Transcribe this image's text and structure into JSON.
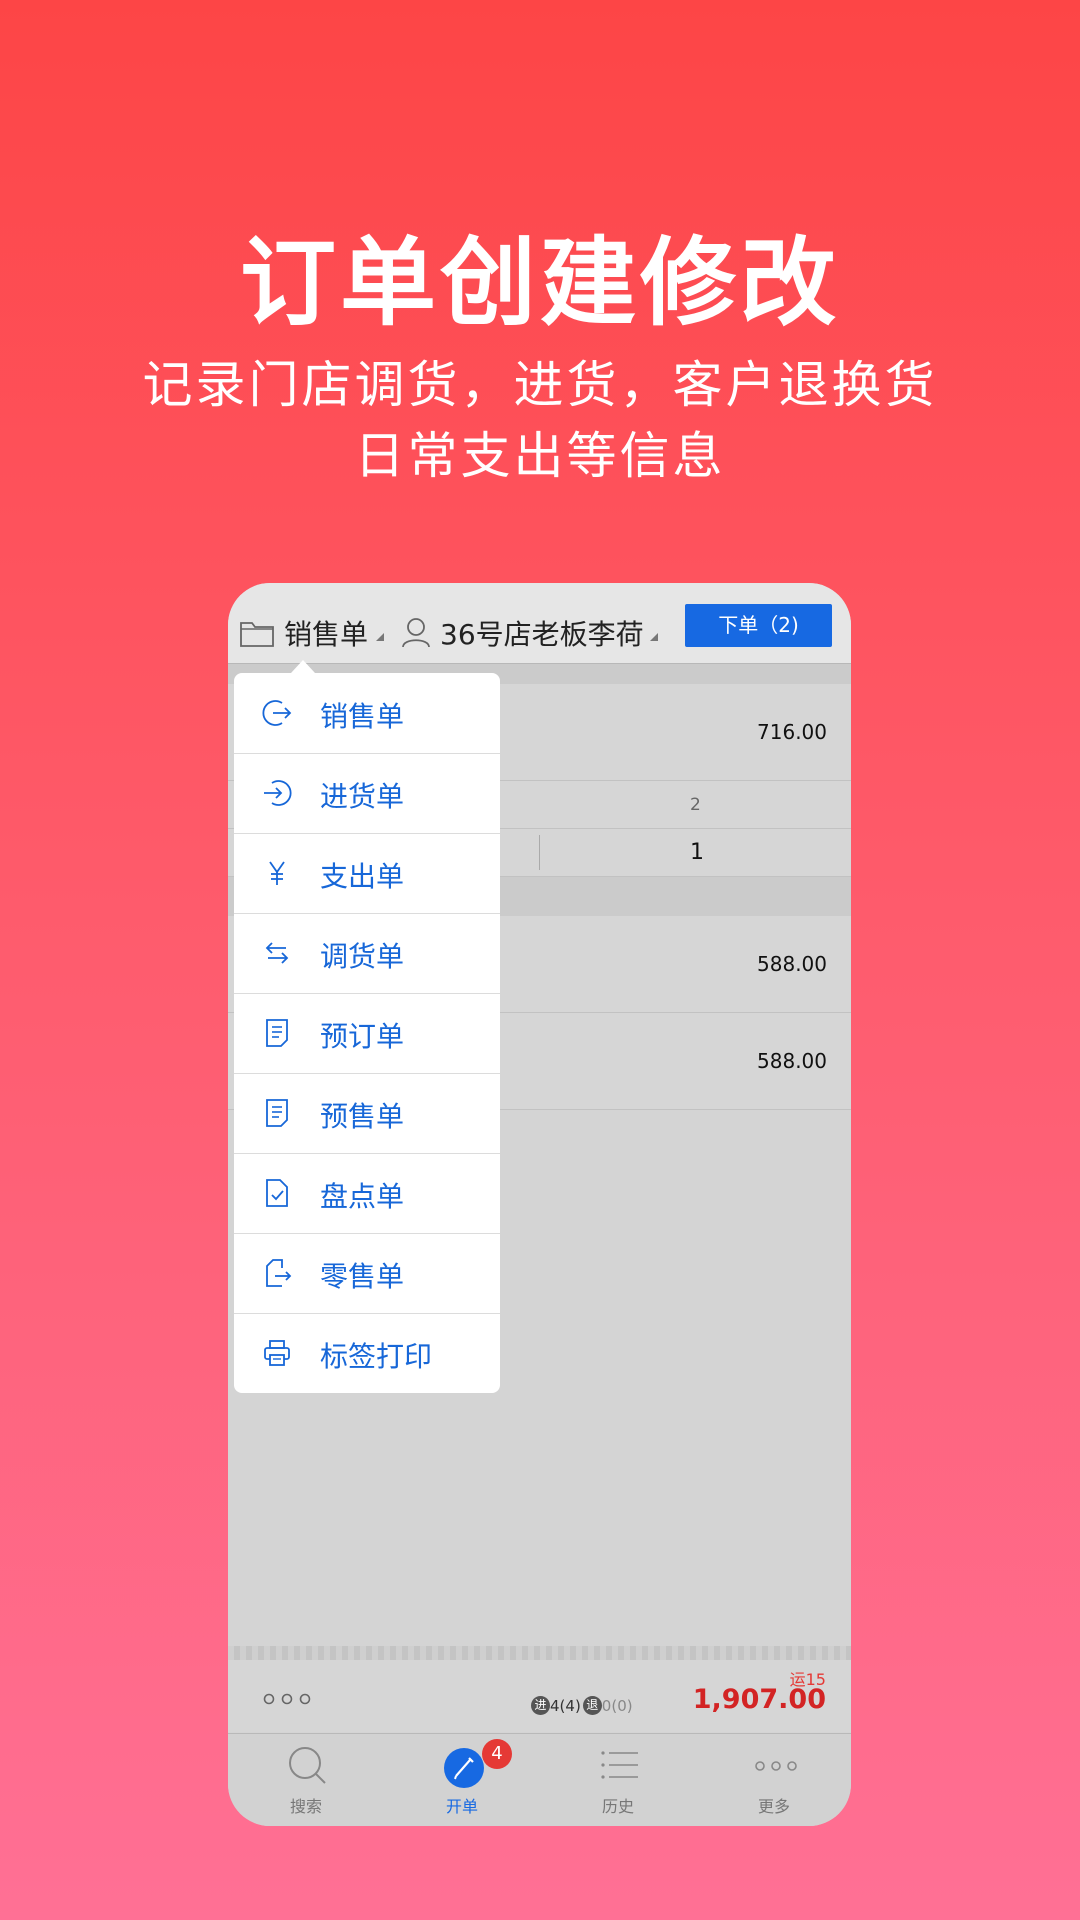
{
  "hero": {
    "title": "订单创建修改",
    "subtitle_line1": "记录门店调货，进货，客户退换货",
    "subtitle_line2": "日常支出等信息"
  },
  "topbar": {
    "order_type": "销售单",
    "customer": "36号店老板李荷",
    "submit_button": "下单（2)"
  },
  "menu": {
    "items": [
      {
        "label": "销售单",
        "icon": "exit-arrow-icon"
      },
      {
        "label": "进货单",
        "icon": "enter-arrow-icon"
      },
      {
        "label": "支出单",
        "icon": "yen-icon"
      },
      {
        "label": "调货单",
        "icon": "swap-arrows-icon"
      },
      {
        "label": "预订单",
        "icon": "document-icon"
      },
      {
        "label": "预售单",
        "icon": "document-icon"
      },
      {
        "label": "盘点单",
        "icon": "checklist-doc-icon"
      },
      {
        "label": "零售单",
        "icon": "retail-doc-icon"
      },
      {
        "label": "标签打印",
        "icon": "printer-icon"
      }
    ]
  },
  "list": {
    "row1_amount": "716.00",
    "size_header": "2",
    "size_qty": "1",
    "row2_amount": "588.00",
    "row3_amount": "588.00"
  },
  "summary": {
    "in_label": "进",
    "in_count": "4(4)",
    "out_label": "退",
    "out_count": "0(0)",
    "freight": "运15",
    "total": "1,907.00"
  },
  "tabs": [
    {
      "label": "搜索",
      "icon": "search-icon"
    },
    {
      "label": "开单",
      "icon": "pencil-icon",
      "badge": "4"
    },
    {
      "label": "历史",
      "icon": "list-icon"
    },
    {
      "label": "更多",
      "icon": "more-dots-icon"
    }
  ],
  "colors": {
    "accent_blue": "#1769e2",
    "total_red": "#d32424",
    "bg_top": "#fd4546",
    "bg_bottom": "#ff7095"
  }
}
